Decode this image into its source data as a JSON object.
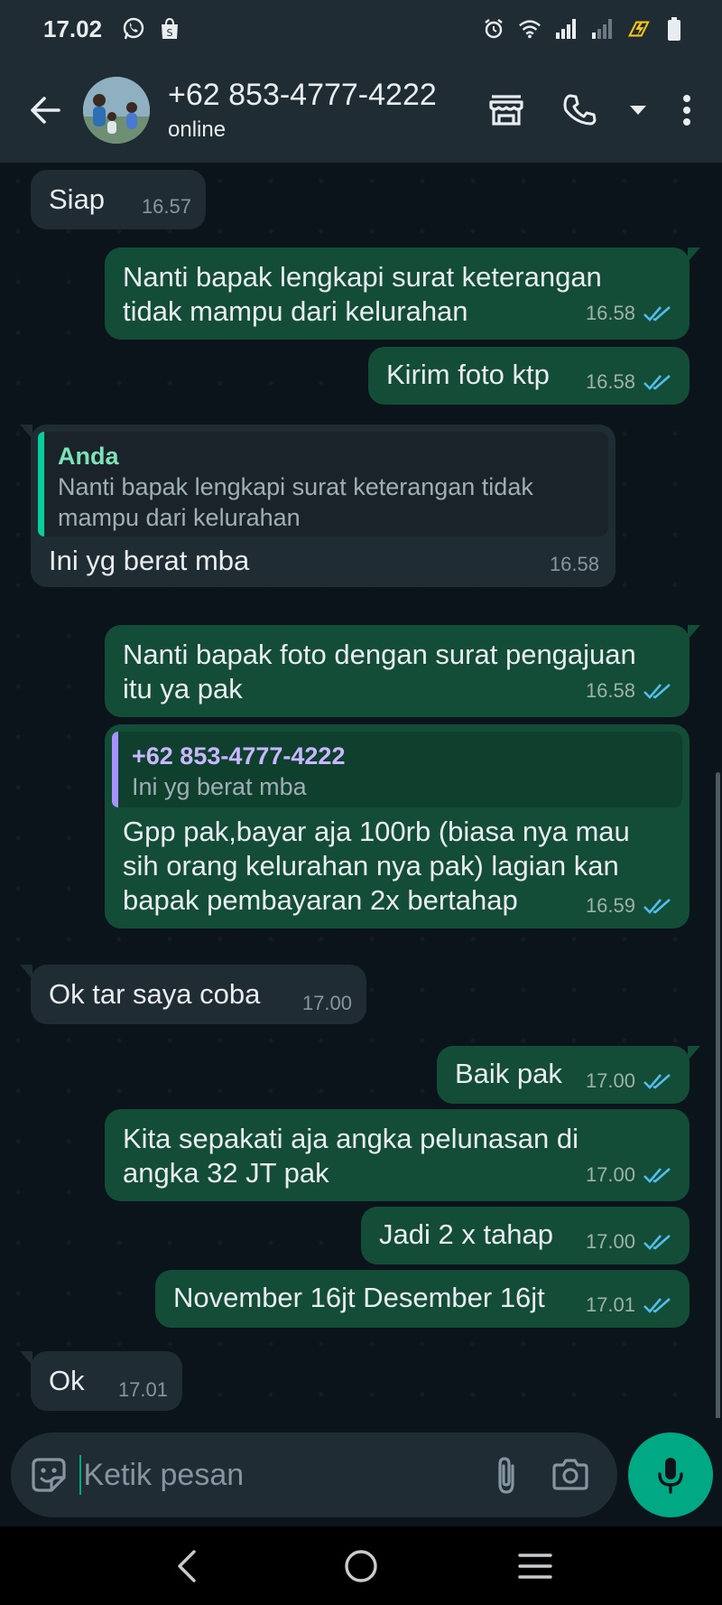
{
  "status_bar": {
    "time": "17.02",
    "left_icons": [
      "whatsapp-icon",
      "shopee-bag-icon"
    ],
    "right_icons": [
      "alarm-icon",
      "wifi-icon",
      "signal-icon",
      "signal-weak-icon",
      "charging-icon",
      "battery-icon"
    ]
  },
  "header": {
    "contact_name": "+62 853-4777-4222",
    "contact_status": "online",
    "icons": [
      "back-arrow-icon",
      "store-icon",
      "phone-icon",
      "dropdown-caret-icon",
      "more-vert-icon"
    ]
  },
  "messages": [
    {
      "dir": "in",
      "text": "Siap",
      "time": "16.57"
    },
    {
      "dir": "out",
      "text": "Nanti bapak lengkapi surat keterangan\ntidak mampu dari kelurahan",
      "time": "16.58",
      "status": "read"
    },
    {
      "dir": "out",
      "text": "Kirim foto ktp",
      "time": "16.58",
      "status": "read"
    },
    {
      "dir": "in",
      "quote_author": "Anda",
      "quote_text": "Nanti bapak lengkapi surat keterangan tidak\nmampu dari kelurahan",
      "text": "Ini yg berat mba",
      "time": "16.58"
    },
    {
      "dir": "out",
      "text": "Nanti bapak foto dengan surat pengajuan\nitu ya pak",
      "time": "16.58",
      "status": "read"
    },
    {
      "dir": "out",
      "quote_author": "+62 853-4777-4222",
      "quote_text": "Ini yg berat mba",
      "text": "Gpp pak,bayar aja 100rb (biasa nya mau\nsih orang kelurahan nya pak) lagian kan\nbapak pembayaran 2x bertahap",
      "time": "16.59",
      "status": "read"
    },
    {
      "dir": "in",
      "text": "Ok tar saya coba",
      "time": "17.00"
    },
    {
      "dir": "out",
      "text": "Baik pak",
      "time": "17.00",
      "status": "read"
    },
    {
      "dir": "out",
      "text": "Kita sepakati aja angka pelunasan di\nangka 32 JT pak",
      "time": "17.00",
      "status": "read"
    },
    {
      "dir": "out",
      "text": "Jadi 2 x tahap",
      "time": "17.00",
      "status": "read"
    },
    {
      "dir": "out",
      "text": "November 16jt Desember 16jt",
      "time": "17.01",
      "status": "read"
    },
    {
      "dir": "in",
      "text": "Ok",
      "time": "17.01"
    }
  ],
  "input": {
    "placeholder": "Ketik pesan",
    "icons": [
      "sticker-emoji-icon",
      "paperclip-icon",
      "camera-icon",
      "microphone-icon"
    ]
  },
  "nav": {
    "icons": [
      "nav-back-icon",
      "nav-home-icon",
      "nav-recents-icon"
    ]
  },
  "colors": {
    "background": "#0b141a",
    "bar": "#1f2c34",
    "incoming_bubble": "#202c33",
    "outgoing_bubble": "#134d37",
    "accent": "#00a884",
    "read_ticks": "#53bdeb"
  }
}
